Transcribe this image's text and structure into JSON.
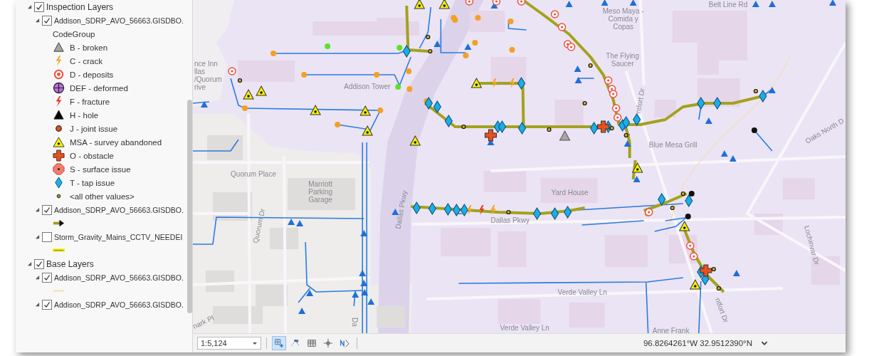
{
  "contents": {
    "items": [
      {
        "kind": "group",
        "label": "Inspection Layers",
        "checked": true,
        "expanded": true,
        "children": [
          {
            "kind": "layer",
            "label": "Addison_SDRP_AVO_56663.GISDBO.",
            "checked": true,
            "expanded": true,
            "legend_heading": "CodeGroup",
            "legend": [
              {
                "kind": "triangle",
                "color": "#a6a6a6",
                "label": "B - broken"
              },
              {
                "kind": "bolt",
                "color": "#f5a623",
                "label": "C - crack"
              },
              {
                "kind": "target",
                "color": "#f0503c",
                "label": "D - deposits"
              },
              {
                "kind": "crosshair",
                "color": "#c070e0",
                "label": "DEF - deformed"
              },
              {
                "kind": "bolt",
                "color": "#e83a20",
                "label": "F - fracture"
              },
              {
                "kind": "triangle",
                "color": "#000000",
                "label": "H - hole"
              },
              {
                "kind": "dot",
                "color": "#e8501e",
                "label": "J - joint issue"
              },
              {
                "kind": "dot-triangle",
                "color": "#f5f500",
                "label": "MSA - survey abandoned"
              },
              {
                "kind": "plus",
                "color": "#e8501e",
                "label": "O - obstacle"
              },
              {
                "kind": "octagon",
                "color": "#f47c6c",
                "label": "S - surface issue"
              },
              {
                "kind": "diamond",
                "color": "#1aaee8",
                "label": "T - tap issue"
              },
              {
                "kind": "small-dot",
                "color": "#a08c1c",
                "label": "<all other values>"
              }
            ]
          },
          {
            "kind": "layer",
            "label": "Addison_SDRP_AVO_56663.GISDBO.",
            "checked": true,
            "expanded": true,
            "legend": [
              {
                "kind": "arrow-line",
                "color": "#9c9a1c"
              }
            ]
          },
          {
            "kind": "layer",
            "label": "Storm_Gravity_Mains_CCTV_NEEDEI",
            "checked": false,
            "expanded": true,
            "legend": [
              {
                "kind": "glow-line",
                "color": "#f2ee00"
              }
            ]
          }
        ]
      },
      {
        "kind": "group",
        "label": "Base Layers",
        "checked": true,
        "expanded": true,
        "children": [
          {
            "kind": "layer",
            "label": "Addison_SDRP_AVO_56663.GISDBO.",
            "checked": true,
            "expanded": true,
            "legend": [
              {
                "kind": "plain-line",
                "color": "#f4e6c4"
              }
            ]
          },
          {
            "kind": "layer",
            "label": "Addison_SDRP_AVO_56663.GISDBO.",
            "checked": true,
            "expanded": true
          }
        ]
      }
    ]
  },
  "map": {
    "labels": [
      {
        "text": "nce Inn"
      },
      {
        "text": "llas"
      },
      {
        "text": "/Quorum"
      },
      {
        "text": "rive"
      },
      {
        "text": "Addison Tower"
      },
      {
        "text": "Quorum Place"
      },
      {
        "text": "Marriott"
      },
      {
        "text": "Parking"
      },
      {
        "text": "Garage"
      },
      {
        "text": "Dallas Pkwy"
      },
      {
        "text": "Meso Maya -"
      },
      {
        "text": "Comida y"
      },
      {
        "text": "Copas"
      },
      {
        "text": "The Flying"
      },
      {
        "text": "Saucer"
      },
      {
        "text": "Belt Line Rd"
      },
      {
        "text": "ntfort Dr"
      },
      {
        "text": "Blue Mesa Grill"
      },
      {
        "text": "Oaks North D"
      },
      {
        "text": "Yard House"
      },
      {
        "text": "Dallas Pkwy"
      },
      {
        "text": "Quorum Dr"
      },
      {
        "text": "Lochinvar Dr"
      },
      {
        "text": "Verde Valley Ln"
      },
      {
        "text": "Verde Valley Ln"
      },
      {
        "text": "ntfort Dr"
      },
      {
        "text": "Anne Frank"
      },
      {
        "text": "nark Pl"
      },
      {
        "text": "Da"
      }
    ]
  },
  "status_bar": {
    "scale": "1:5,124",
    "tools": [
      {
        "kind": "grid-plus",
        "selected": true
      },
      {
        "kind": "snap",
        "selected": false
      },
      {
        "kind": "table",
        "selected": false
      },
      {
        "kind": "crosshair",
        "selected": false
      },
      {
        "kind": "north-arrow",
        "selected": false
      }
    ],
    "coordinates": "96.8264261°W 32.9512390°N"
  }
}
